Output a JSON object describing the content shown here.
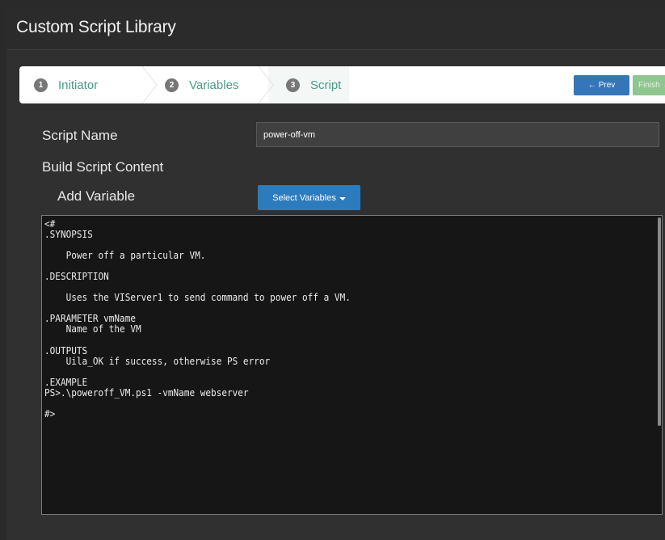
{
  "title": "Custom Script Library",
  "wizard": {
    "steps": [
      {
        "num": "1",
        "label": "Initiator"
      },
      {
        "num": "2",
        "label": "Variables"
      },
      {
        "num": "3",
        "label": "Script"
      }
    ],
    "prev_label": "Prev",
    "finish_label": "Finish"
  },
  "form": {
    "script_name_label": "Script Name",
    "script_name_value": "power-off-vm",
    "build_label": "Build Script Content",
    "add_variable_label": "Add Variable",
    "select_variables_label": "Select Variables"
  },
  "script": {
    "content": "<#\n.SYNOPSIS\n\n    Power off a particular VM.\n\n.DESCRIPTION\n\n    Uses the VIServer1 to send command to power off a VM.\n\n.PARAMETER vmName\n    Name of the VM\n\n.OUTPUTS\n    Uila_OK if success, otherwise PS error\n\n.EXAMPLE\nPS>.\\poweroff_VM.ps1 -vmName webserver\n\n#>"
  },
  "colors": {
    "background": "#2a2a2a",
    "accent": "#2b7bbd",
    "step_text": "#4a9a8a",
    "finish": "#8fc58f"
  }
}
